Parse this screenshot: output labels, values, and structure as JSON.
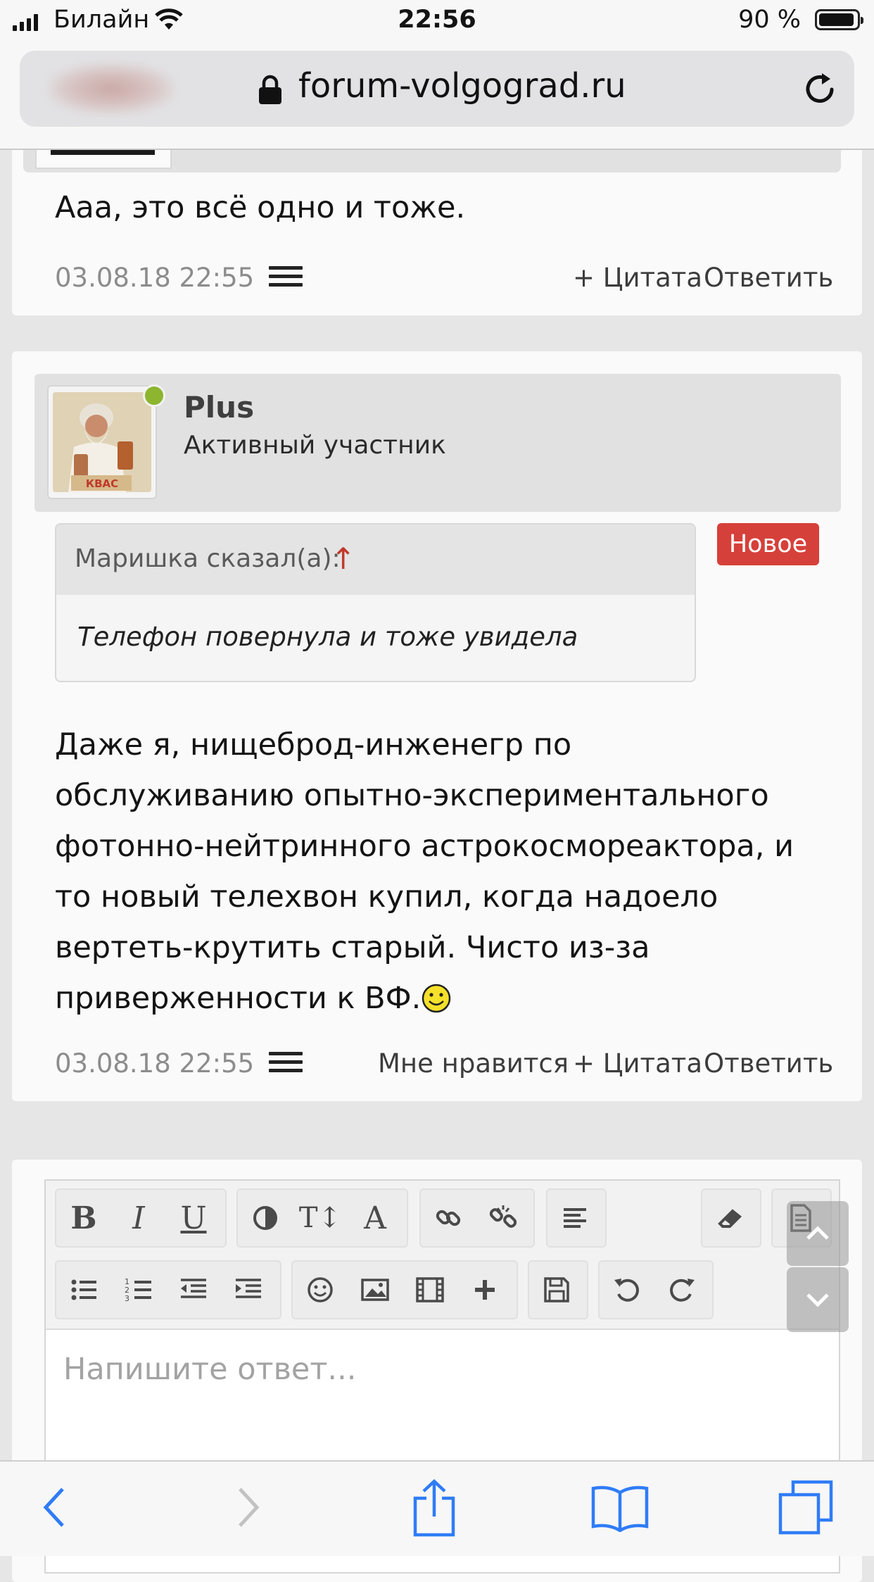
{
  "status_bar": {
    "carrier": "Билайн",
    "time": "22:56",
    "battery": "90 %"
  },
  "browser": {
    "url": "forum-volgograd.ru"
  },
  "posts": [
    {
      "message": "Ааа, это всё одно и тоже.",
      "date": "03.08.18 22:55",
      "quote_action": "+ Цитата",
      "reply_action": "Ответить"
    },
    {
      "username": "Plus",
      "user_title": "Активный участник",
      "avatar_caption": "КВАС",
      "badge": "Новое",
      "quote": {
        "author": "Маришка сказал(а):",
        "arrow": "↑",
        "text": "Телефон повернула и тоже увидела"
      },
      "message_lines": [
        "Даже я, нищеброд-инженегр по",
        "обслуживанию опытно-экспериментального",
        "фотонно-нейтринного астрокосмореактора, и",
        "то новый телехвон купил, когда надоело",
        "вертеть-крутить старый. Чисто из-за",
        "приверженности к ВФ."
      ],
      "date": "03.08.18 22:55",
      "like_action": "Мне нравится",
      "quote_action": "+ Цитата",
      "reply_action": "Ответить"
    }
  ],
  "editor": {
    "placeholder": "Напишите ответ...",
    "toolbar_row1": [
      "bold-icon",
      "italic-icon",
      "underline-icon",
      "color-icon",
      "font-size-icon",
      "font-family-icon",
      "link-icon",
      "unlink-icon",
      "align-icon",
      "remove-format-icon",
      "template-icon"
    ],
    "toolbar_row2": [
      "bullet-list-icon",
      "numbered-list-icon",
      "outdent-icon",
      "indent-icon",
      "smilie-icon",
      "image-icon",
      "media-icon",
      "insert-icon",
      "save-draft-icon",
      "undo-icon",
      "redo-icon"
    ],
    "bold_glyph": "B",
    "italic_glyph": "I",
    "underline_glyph": "U",
    "font_size_glyph": "T↕",
    "font_family_glyph": "A"
  },
  "colors": {
    "new_badge": "#d6403a",
    "online_dot": "#8db52f",
    "ios_blue": "#2f7cf6"
  }
}
